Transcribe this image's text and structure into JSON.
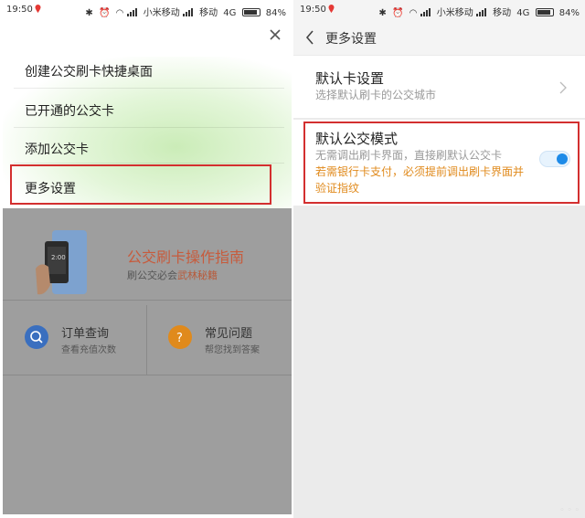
{
  "left": {
    "status": {
      "time": "19:50",
      "carrier1": "小米移动",
      "carrier2": "移动",
      "network": "4G",
      "battery": "84%"
    },
    "menu": {
      "items": [
        {
          "label": "创建公交刷卡快捷桌面"
        },
        {
          "label": "已开通的公交卡"
        },
        {
          "label": "添加公交卡"
        },
        {
          "label": "更多设置"
        }
      ],
      "close_icon": "close-icon"
    },
    "banner": {
      "title": "公交刷卡操作指南",
      "subtitle_prefix": "刷公交必会",
      "subtitle_highlight": "武林秘籍"
    },
    "quick": [
      {
        "title": "订单查询",
        "subtitle": "查看充值次数",
        "icon": "search-icon",
        "color": "#3a6fbf"
      },
      {
        "title": "常见问题",
        "subtitle": "帮您找到答案",
        "icon": "question-icon",
        "color": "#e08a1c"
      }
    ]
  },
  "right": {
    "status": {
      "time": "19:50",
      "carrier1": "小米移动",
      "carrier2": "移动",
      "network": "4G",
      "battery": "84%"
    },
    "header": {
      "title": "更多设置"
    },
    "default_card": {
      "title": "默认卡设置",
      "subtitle": "选择默认刷卡的公交城市"
    },
    "default_mode": {
      "title": "默认公交模式",
      "desc": "无需调出刷卡界面，直接刷默认公交卡",
      "warning": "若需银行卡支付，必须提前调出刷卡界面并验证指纹",
      "enabled": true
    }
  },
  "colors": {
    "accent_red": "#d32f2f",
    "toggle_blue": "#1e8be8",
    "warning_orange": "#e08a1c"
  }
}
